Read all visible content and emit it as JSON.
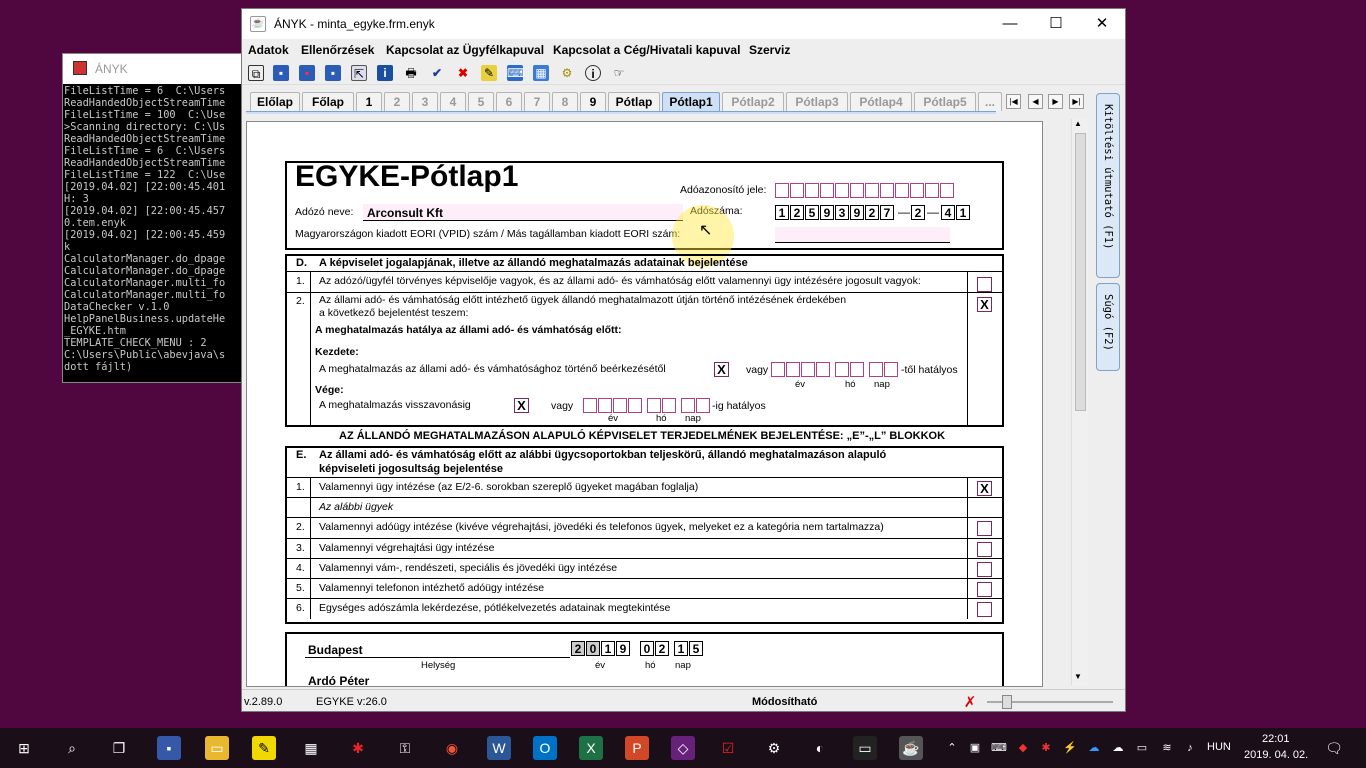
{
  "console": {
    "title": "ÁNYK",
    "lines": [
      "FileListTime = 6  C:\\Users",
      "ReadHandedObjectStreamTime",
      "FileListTime = 100  C:\\Use",
      ">Scanning directory: C:\\Us",
      "ReadHandedObjectStreamTime",
      "FileListTime = 6  C:\\Users",
      "ReadHandedObjectStreamTime",
      "FileListTime = 122  C:\\Use",
      "[2019.04.02] [22:00:45.401",
      "H: 3",
      "[2019.04.02] [22:00:45.457",
      "0.tem.enyk",
      "[2019.04.02] [22:00:45.459",
      "k",
      "CalculatorManager.do_dpage",
      "CalculatorManager.do_dpage",
      "CalculatorManager.multi_fo",
      "CalculatorManager.multi_fo",
      "DataChecker v.1.0",
      "HelpPanelBusiness.updateHe",
      "_EGYKE.htm",
      "TEMPLATE_CHECK_MENU : 2",
      "C:\\Users\\Public\\abevjava\\s",
      "dott fájlt)"
    ]
  },
  "window": {
    "title": "ÁNYK - minta_egyke.frm.enyk",
    "icon": "java-icon"
  },
  "menu": [
    "Adatok",
    "Ellenőrzések",
    "Kapcsolat az Ügyfélkapuval",
    "Kapcsolat a Cég/Hivatali kapuval",
    "Szerviz"
  ],
  "toolbar": [
    "copy-icon",
    "save-icon",
    "save-as-icon",
    "save-all-icon",
    "export-icon",
    "info-doc-icon",
    "print-icon",
    "check-icon",
    "delete-icon",
    "edit-icon",
    "keyboard-icon",
    "calculator-icon",
    "tools-icon",
    "info-icon",
    "pointer-icon"
  ],
  "tabs": [
    {
      "label": "Előlap",
      "state": "active"
    },
    {
      "label": "Főlap",
      "state": "active"
    },
    {
      "label": "1",
      "state": "active"
    },
    {
      "label": "2",
      "state": "dim"
    },
    {
      "label": "3",
      "state": "dim"
    },
    {
      "label": "4",
      "state": "dim"
    },
    {
      "label": "5",
      "state": "dim"
    },
    {
      "label": "6",
      "state": "dim"
    },
    {
      "label": "7",
      "state": "dim"
    },
    {
      "label": "8",
      "state": "dim"
    },
    {
      "label": "9",
      "state": "active"
    },
    {
      "label": "Pótlap",
      "state": "active"
    },
    {
      "label": "Pótlap1",
      "state": "selected"
    },
    {
      "label": "Pótlap2",
      "state": "dim"
    },
    {
      "label": "Pótlap3",
      "state": "dim"
    },
    {
      "label": "Pótlap4",
      "state": "dim"
    },
    {
      "label": "Pótlap5",
      "state": "dim"
    },
    {
      "label": "...",
      "state": "dim"
    }
  ],
  "side_tabs": [
    "Kitöltési útmutató (F1)",
    "Súgó (F2)"
  ],
  "form": {
    "title": "EGYKE-Pótlap1",
    "taxid_label": "Adóazonosító jele:",
    "name_label": "Adózó neve:",
    "name_value": "Arconsult Kft",
    "taxnum_label": "Adószáma:",
    "taxnum_digits": [
      "1",
      "2",
      "5",
      "9",
      "3",
      "9",
      "2",
      "7",
      "2",
      "4",
      "1"
    ],
    "eori_label": "Magyarországon kiadott EORI (VPID) szám / Más tagállamban kiadott EORI szám:",
    "d_letter": "D.",
    "d_title": "A képviselet jogalapjának, illetve az állandó meghatalmazás adatainak bejelentése",
    "d1_num": "1.",
    "d1": "Az adózó/ügyfél törvényes képviselője vagyok, és az állami adó- és vámhatóság előtt valamennyi ügy intézésére jogosult vagyok:",
    "d2_num": "2.",
    "d2a": "Az állami adó- és vámhatóság előtt intézhető ügyek állandó meghatalmazott útján történő intézésének érdekében",
    "d2b": "a következő bejelentést teszem:",
    "d2_mark": "X",
    "hatalya": "A meghatalmazás hatálya az állami adó- és vámhatóság előtt:",
    "kezdete": "Kezdete:",
    "kezdete_text": "A meghatalmazás  az állami adó- és vámhatósághoz történő beérkezésétől",
    "kezdete_mark": "X",
    "vagy": "vagy",
    "tol": "-től hatályos",
    "ev": "év",
    "ho": "hó",
    "nap": "nap",
    "vege": "Vége:",
    "vege_text": "A meghatalmazás  visszavonásig",
    "vege_mark": "X",
    "ig": "-ig hatályos",
    "banner": "AZ ÁLLANDÓ MEGHATALMAZÁSON ALAPULÓ KÉPVISELET TERJEDELMÉNEK BEJELENTÉSE: „E”-„L” BLOKKOK",
    "e_letter": "E.",
    "e_title_1": "Az állami adó- és vámhatóság előtt az alábbi ügycsoportokban teljeskörű, állandó meghatalmazáson alapuló",
    "e_title_2": "képviseleti jogosultság bejelentése",
    "e_rows": [
      {
        "num": "1.",
        "text": "Valamennyi ügy intézése (az E/2-6. sorokban szereplő ügyeket magában foglalja)",
        "mark": "X"
      },
      {
        "num": "",
        "text": "Az alábbi ügyek",
        "mark": ""
      },
      {
        "num": "2.",
        "text": "Valamennyi adóügy intézése (kivéve végrehajtási, jövedéki és telefonos ügyek, melyeket ez a kategória nem tartalmazza)",
        "mark": ""
      },
      {
        "num": "3.",
        "text": "Valamennyi végrehajtási ügy intézése",
        "mark": ""
      },
      {
        "num": "4.",
        "text": "Valamennyi vám-, rendészeti, speciális és jövedéki ügy intézése",
        "mark": ""
      },
      {
        "num": "5.",
        "text": "Valamennyi telefonon intézhető adóügy intézése",
        "mark": ""
      },
      {
        "num": "6.",
        "text": "Egységes adószámla lekérdezése, pótlékelvezetés adatainak megtekintése",
        "mark": ""
      }
    ],
    "place": "Budapest",
    "place_label": "Helység",
    "date_digits": [
      "2",
      "0",
      "1",
      "9",
      "0",
      "2",
      "1",
      "5"
    ],
    "signer": "Ardó Péter"
  },
  "status": {
    "version": "v.2.89.0",
    "form_version": "EGYKE v:26.0",
    "mode": "Módosítható"
  },
  "taskbar": {
    "lang": "HUN",
    "time": "22:01",
    "date": "2019. 04. 02."
  }
}
